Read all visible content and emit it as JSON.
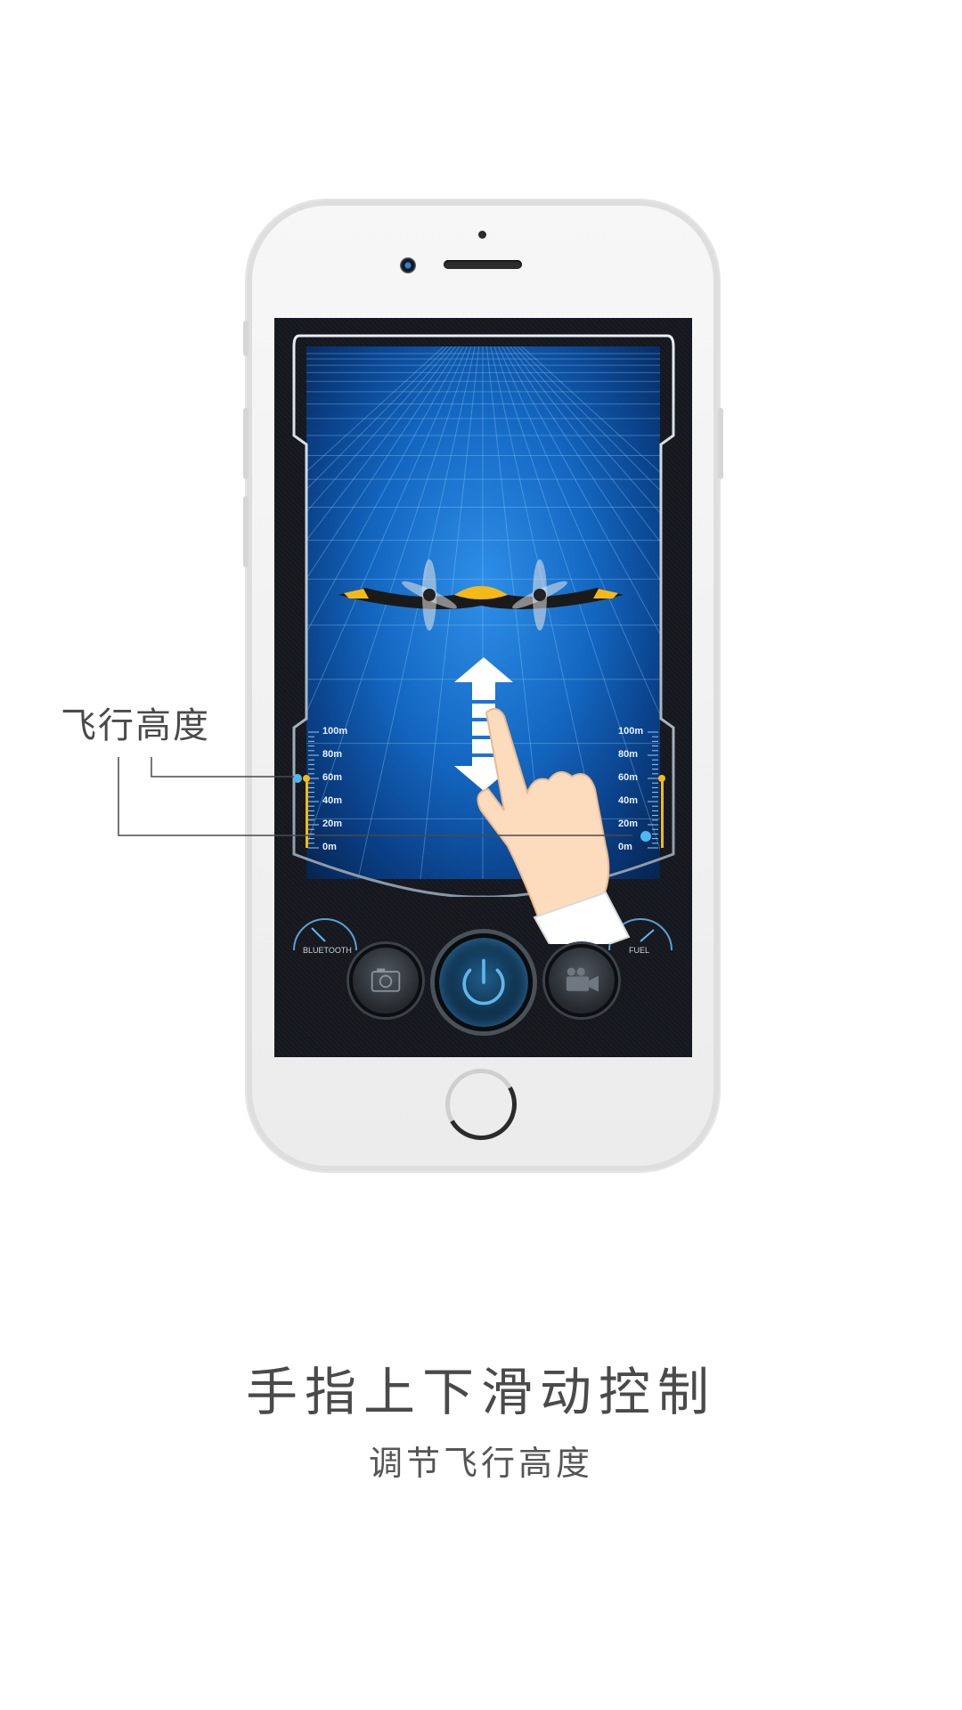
{
  "callout": {
    "label": "飞行高度"
  },
  "hud": {
    "left_scale": [
      "100m",
      "80m",
      "60m",
      "40m",
      "20m",
      "0m"
    ],
    "right_scale": [
      "100m",
      "80m",
      "60m",
      "40m",
      "20m",
      "0m"
    ],
    "left_level_fraction": 0.6,
    "right_level_fraction": 0.1,
    "bluetooth_gauge": {
      "label": "BLUETOOTH",
      "ticks": [
        "0",
        "10",
        "20",
        "30",
        "40",
        "50",
        "60",
        "70",
        "80",
        "90",
        "100"
      ]
    },
    "fuel_gauge": {
      "label": "FUEL",
      "ticks": [
        "0",
        "10",
        "20",
        "30",
        "40",
        "50",
        "60",
        "70",
        "80",
        "90",
        "100"
      ]
    }
  },
  "controls": {
    "camera_icon": "camera-icon",
    "power_icon": "power-icon",
    "video_icon": "video-camera-icon"
  },
  "headline": {
    "title": "手指上下滑动控制",
    "subtitle": "调节飞行高度"
  },
  "colors": {
    "accent_blue": "#1a73d8",
    "drone_yellow": "#f5b915",
    "text_gray": "#4a4a4a"
  }
}
